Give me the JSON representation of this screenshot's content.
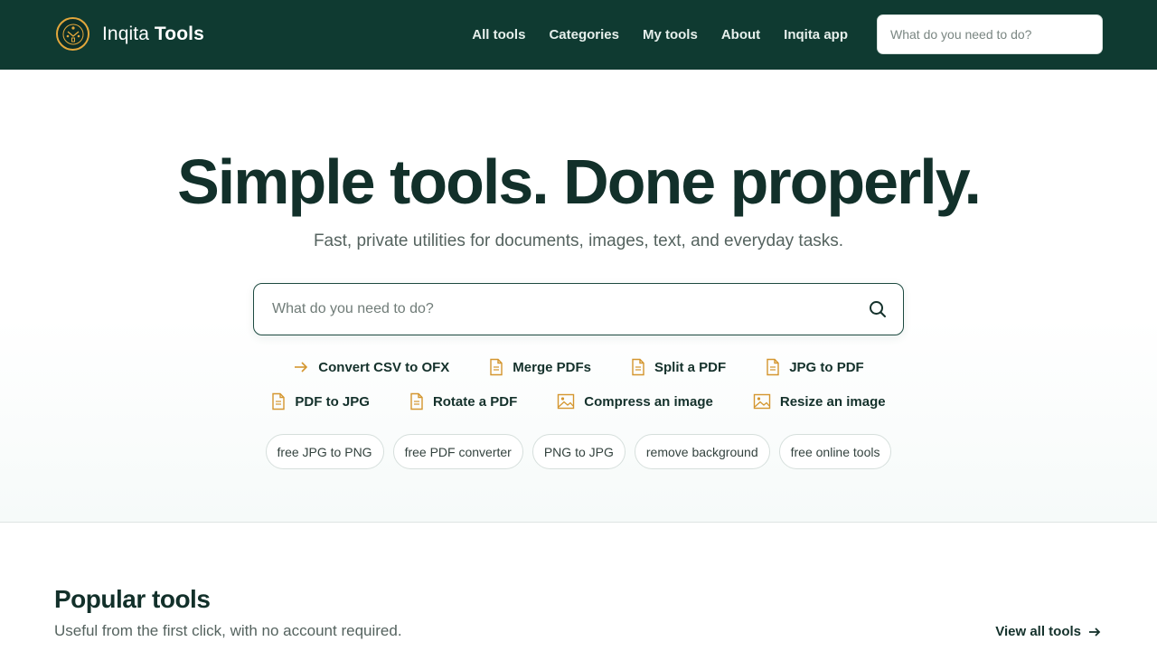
{
  "header": {
    "brand_light": "Inqita",
    "brand_bold": "Tools",
    "nav": [
      "All tools",
      "Categories",
      "My tools",
      "About",
      "Inqita app"
    ],
    "search_placeholder": "What do you need to do?"
  },
  "hero": {
    "title": "Simple tools. Done properly.",
    "subtitle": "Fast, private utilities for documents, images, text, and everyday tasks.",
    "search_placeholder": "What do you need to do?",
    "quick_links_row1": [
      {
        "label": "Convert CSV to OFX",
        "icon": "arrow-right-icon"
      },
      {
        "label": "Merge PDFs",
        "icon": "document-icon"
      },
      {
        "label": "Split a PDF",
        "icon": "document-icon"
      },
      {
        "label": "JPG to PDF",
        "icon": "document-icon"
      }
    ],
    "quick_links_row2": [
      {
        "label": "PDF to JPG",
        "icon": "document-icon"
      },
      {
        "label": "Rotate a PDF",
        "icon": "document-icon"
      },
      {
        "label": "Compress an image",
        "icon": "image-icon"
      },
      {
        "label": "Resize an image",
        "icon": "image-icon"
      }
    ],
    "chips": [
      "free JPG to PNG",
      "free PDF converter",
      "PNG to JPG",
      "remove background",
      "free online tools"
    ]
  },
  "popular": {
    "title": "Popular tools",
    "subtitle": "Useful from the first click, with no account required.",
    "view_all": "View all tools"
  },
  "colors": {
    "header_bg": "#0f3a31",
    "accent": "#e2a73c",
    "text_dark": "#12302a"
  }
}
